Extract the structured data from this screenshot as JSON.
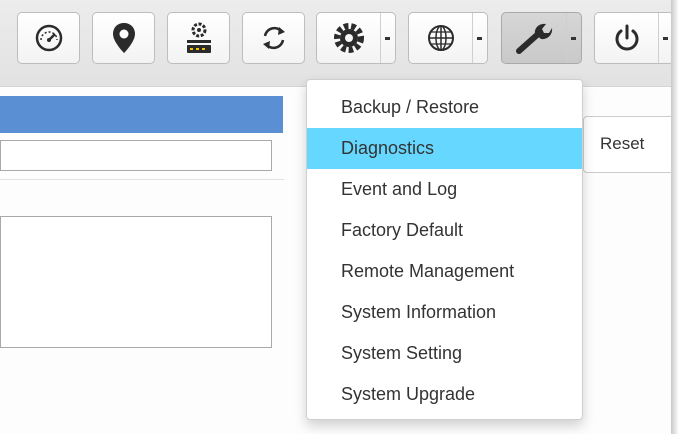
{
  "toolbar": {
    "buttons": [
      {
        "icon": "dashboard-gauge-icon"
      },
      {
        "icon": "location-pin-icon"
      },
      {
        "icon": "network-device-icon"
      },
      {
        "icon": "refresh-icon"
      },
      {
        "icon": "gear-icon",
        "has_dropdown": true
      },
      {
        "icon": "globe-icon",
        "has_dropdown": true
      },
      {
        "icon": "wrench-icon",
        "has_dropdown": true,
        "active": true
      },
      {
        "icon": "power-icon",
        "has_dropdown": true
      }
    ]
  },
  "actions": {
    "reset_label": "Reset"
  },
  "tools_menu": {
    "items": [
      {
        "label": "Backup / Restore"
      },
      {
        "label": "Diagnostics",
        "highlighted": true
      },
      {
        "label": "Event and Log"
      },
      {
        "label": "Factory Default"
      },
      {
        "label": "Remote Management"
      },
      {
        "label": "System Information"
      },
      {
        "label": "System Setting"
      },
      {
        "label": "System Upgrade"
      }
    ]
  },
  "colors": {
    "highlight": "#66d8ff",
    "section_bar": "#5b8fd4"
  }
}
